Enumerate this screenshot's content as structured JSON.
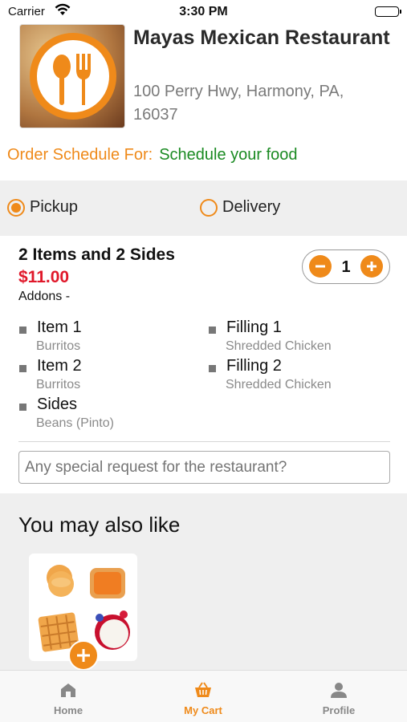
{
  "status": {
    "carrier": "Carrier",
    "time": "3:30 PM"
  },
  "restaurant": {
    "name": "Mayas Mexican Restaurant",
    "address": "100 Perry Hwy, Harmony, PA, 16037"
  },
  "schedule": {
    "label": "Order Schedule For:",
    "value": "Schedule your food"
  },
  "order_type": {
    "pickup": "Pickup",
    "delivery": "Delivery",
    "selected": "pickup"
  },
  "cart_item": {
    "title": "2 Items and 2 Sides",
    "price": "$11.00",
    "addons": "Addons -",
    "quantity": "1",
    "options": [
      {
        "key": "Item 1",
        "value": "Burritos"
      },
      {
        "key": "Filling 1",
        "value": "Shredded Chicken"
      },
      {
        "key": "Item 2",
        "value": "Burritos"
      },
      {
        "key": "Filling 2",
        "value": "Shredded Chicken"
      },
      {
        "key": "Sides",
        "value": "Beans (Pinto)"
      }
    ]
  },
  "special_request": {
    "placeholder": "Any special request for the restaurant?"
  },
  "suggestions": {
    "title": "You may also like"
  },
  "tabs": [
    {
      "label": "Home",
      "icon": "home-icon"
    },
    {
      "label": "My Cart",
      "icon": "cart-icon"
    },
    {
      "label": "Profile",
      "icon": "profile-icon"
    }
  ],
  "colors": {
    "accent": "#ef8a1a",
    "price": "#e0182a",
    "schedule_value": "#1a8a22"
  }
}
